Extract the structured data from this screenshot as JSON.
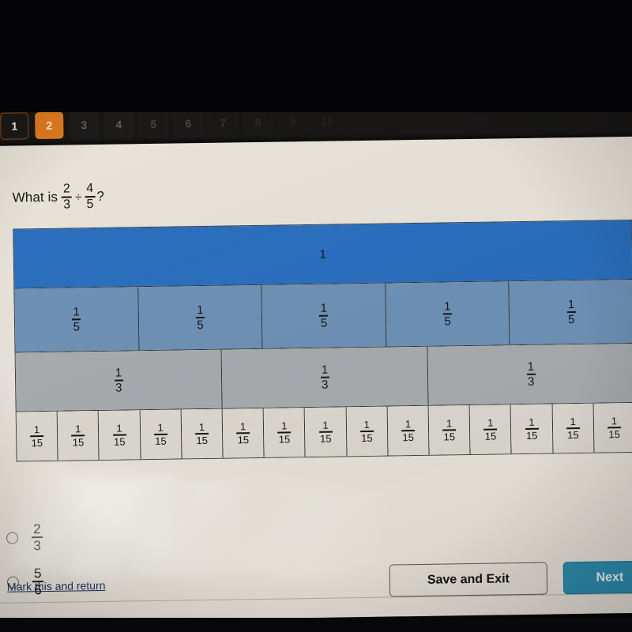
{
  "question_nav": {
    "tabs": [
      {
        "number": "1",
        "state": "visited"
      },
      {
        "number": "2",
        "state": "active"
      },
      {
        "number": "3",
        "state": "upcoming"
      },
      {
        "number": "4",
        "state": "upcoming"
      },
      {
        "number": "5",
        "state": "upcoming"
      },
      {
        "number": "6",
        "state": "upcoming"
      },
      {
        "number": "7",
        "state": "upcoming"
      },
      {
        "number": "8",
        "state": "upcoming"
      },
      {
        "number": "9",
        "state": "upcoming"
      },
      {
        "number": "10",
        "state": "upcoming"
      }
    ]
  },
  "question": {
    "lead": "What is",
    "operand_a": {
      "numerator": "2",
      "denominator": "3"
    },
    "operator": "÷",
    "operand_b": {
      "numerator": "4",
      "denominator": "5"
    },
    "terminator": "?"
  },
  "diagram": {
    "whole_label": "1",
    "fifths_label": {
      "numerator": "1",
      "denominator": "5"
    },
    "thirds_label": {
      "numerator": "1",
      "denominator": "3"
    },
    "fifteenths_label": {
      "numerator": "1",
      "denominator": "15"
    },
    "fifths_count": 5,
    "thirds_count": 3,
    "fifteenths_count": 15,
    "colors": {
      "whole": "#2a70c2",
      "fifths": "#6f93b9",
      "thirds": "#a9aeb2",
      "fifteenths": "#dedbd4",
      "border": "#2d3339"
    }
  },
  "choices": [
    {
      "numerator": "2",
      "denominator": "3",
      "selected": false
    },
    {
      "numerator": "5",
      "denominator": "6",
      "selected": false
    }
  ],
  "footer": {
    "mark_link": "Mark this and return",
    "save_button": "Save and Exit",
    "next_button": "Next",
    "next_color": "#2e8fb4"
  }
}
